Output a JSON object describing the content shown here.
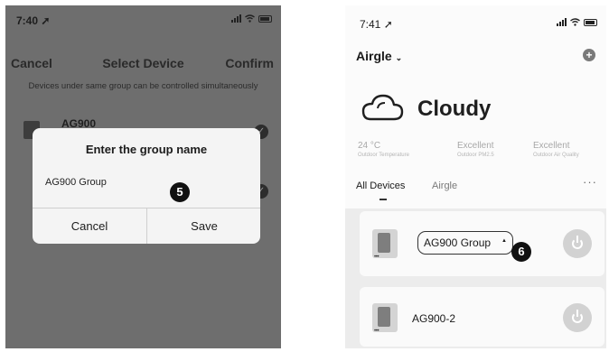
{
  "left_phone": {
    "status": {
      "time": "7:40"
    },
    "nav": {
      "cancel": "Cancel",
      "title": "Select Device",
      "confirm": "Confirm"
    },
    "hint": "Devices under same group can be controlled simultaneously",
    "devices": [
      {
        "name": "AG900",
        "selected": true
      },
      {
        "name": "",
        "selected": true
      }
    ],
    "dialog": {
      "title": "Enter the group name",
      "input_value": "AG900 Group",
      "cancel": "Cancel",
      "save": "Save"
    },
    "step_marker": "5"
  },
  "right_phone": {
    "status": {
      "time": "7:41"
    },
    "home_selector": "Airgle",
    "weather": "Cloudy",
    "metrics": [
      {
        "value": "24 °C",
        "label": "Outdoor Temperature"
      },
      {
        "value": "Excellent",
        "label": "Outdoor PM2.5"
      },
      {
        "value": "Excellent",
        "label": "Outdoor Air Quality"
      }
    ],
    "tabs": [
      {
        "label": "All Devices",
        "active": true
      },
      {
        "label": "Airgle",
        "active": false
      }
    ],
    "device_cards": [
      {
        "name": "AG900 Group",
        "step_marker": "6"
      },
      {
        "name": "AG900-2"
      }
    ]
  },
  "colors": {
    "overlay_gray": "#6e6e6e",
    "marker_black": "#111111",
    "power_button": "#d2d2d2"
  },
  "icons": [
    "navigation-arrow-icon",
    "cellular-signal-icon",
    "wifi-icon",
    "battery-icon",
    "checkmark-icon",
    "add-icon",
    "cloud-icon",
    "more-icon",
    "power-icon",
    "air-purifier-icon",
    "dropdown-chevron-icon"
  ]
}
